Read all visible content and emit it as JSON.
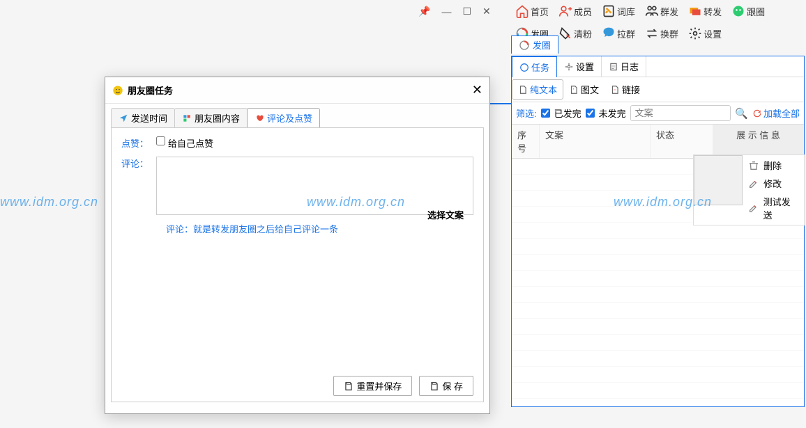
{
  "windowControls": {
    "pin": "📌",
    "min": "—",
    "max": "☐",
    "close": "✕"
  },
  "toolbar": {
    "row1": [
      {
        "id": "home",
        "label": "首页"
      },
      {
        "id": "members",
        "label": "成员"
      },
      {
        "id": "dict",
        "label": "词库"
      },
      {
        "id": "mass",
        "label": "群发"
      },
      {
        "id": "forward",
        "label": "转发"
      },
      {
        "id": "follow",
        "label": "跟圈"
      }
    ],
    "row2": [
      {
        "id": "post",
        "label": "发圈"
      },
      {
        "id": "clean",
        "label": "清粉"
      },
      {
        "id": "pull",
        "label": "拉群"
      },
      {
        "id": "swap",
        "label": "换群"
      },
      {
        "id": "settings",
        "label": "设置"
      }
    ]
  },
  "rightPanel": {
    "outerTab": "发圈",
    "subTabs": [
      {
        "id": "task",
        "label": "任务",
        "active": true
      },
      {
        "id": "rsettings",
        "label": "设置",
        "active": false
      },
      {
        "id": "log",
        "label": "日志",
        "active": false
      }
    ],
    "contentTabs": [
      {
        "id": "text",
        "label": "纯文本",
        "active": true
      },
      {
        "id": "imgtext",
        "label": "图文",
        "active": false
      },
      {
        "id": "link",
        "label": "链接",
        "active": false
      }
    ],
    "filter": {
      "label": "筛选:",
      "sent": "已发完",
      "unsent": "未发完",
      "placeholder": "文案",
      "reload": "加载全部"
    },
    "headers": {
      "h1": "序号",
      "h2": "文案",
      "h3": "状态",
      "h4": "展 示 信 息"
    },
    "actions": {
      "del": "删除",
      "edit": "修改",
      "test": "测试发送"
    }
  },
  "dialog": {
    "title": "朋友圈任务",
    "tabs": [
      {
        "id": "time",
        "label": "发送时间",
        "active": false
      },
      {
        "id": "content",
        "label": "朋友圈内容",
        "active": false
      },
      {
        "id": "comment",
        "label": "评论及点赞",
        "active": true
      }
    ],
    "form": {
      "likeLabel": "点赞：",
      "likeCheckbox": "给自己点赞",
      "commentLabel": "评论：",
      "chooseText": "选择文案",
      "hint": "评论：就是转发朋友圈之后给自己评论一条"
    },
    "footer": {
      "reset": "重置并保存",
      "save": "保 存"
    }
  },
  "watermark": "www.idm.org.cn"
}
